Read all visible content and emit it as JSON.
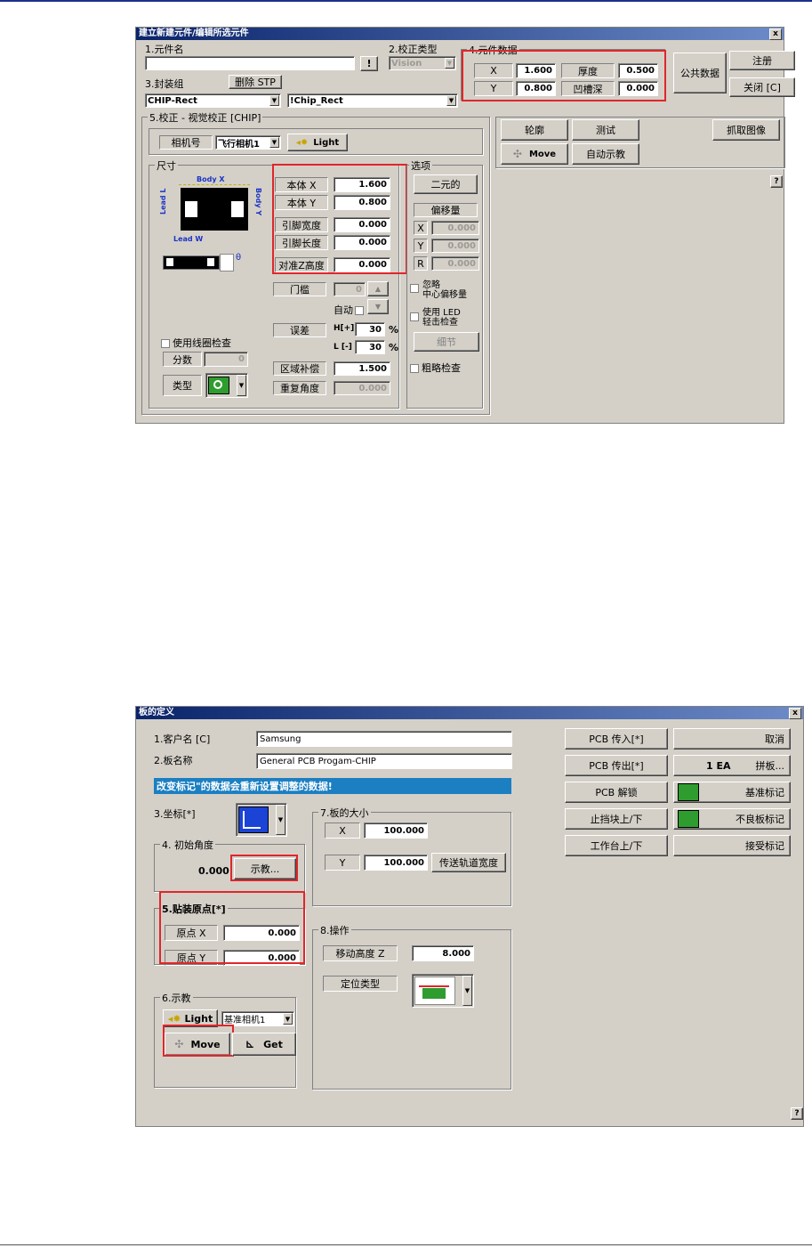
{
  "window1": {
    "title": "建立新建元件/编辑所选元件",
    "close": "x",
    "part_name_label": "1.元件名",
    "part_name_value": "",
    "excl_button": "!",
    "calib_type_label": "2.校正类型",
    "calib_type_value": "Vision",
    "part_data_label": "4.元件数据",
    "x_label": "X",
    "x_value": "1.600",
    "y_label": "Y",
    "y_value": "0.800",
    "thickness_label": "厚度",
    "thickness_value": "0.500",
    "groove_label": "凹槽深",
    "groove_value": "0.000",
    "public_data_button": "公共数据",
    "register_button": "注册",
    "close_button": "关闭 [C]",
    "package_label": "3.封装组",
    "delete_stp_button": "删除 STP",
    "package_value": "CHIP-Rect",
    "package2_value": "!Chip_Rect",
    "vision_group_title": "5.校正 - 视觉校正 [CHIP]",
    "camera_label": "相机号",
    "camera_value": "飞行相机1",
    "light_button": "Light",
    "size_group_title": "尺寸",
    "body_x_diag": "Body X",
    "body_y_diag": "Body Y",
    "lead_l_diag": "Lead L",
    "lead_w_diag": "Lead W",
    "diag_symbol": "θ",
    "body_x_label": "本体 X",
    "body_x_value": "1.600",
    "body_y_label": "本体 Y",
    "body_y_value": "0.800",
    "lead_w_label": "引脚宽度",
    "lead_w_value": "0.000",
    "lead_l_label": "引脚长度",
    "lead_l_value": "0.000",
    "align_z_label": "对准Z高度",
    "align_z_value": "0.000",
    "threshold_label": "门槛",
    "threshold_value": "0",
    "auto_label": "自动",
    "tolerance_label": "误差",
    "h_label": "H[+]",
    "h_value": "30",
    "l_label": "L [-]",
    "l_value": "30",
    "percent": "%",
    "region_comp_label": "区域补偿",
    "region_comp_value": "1.500",
    "repeat_angle_label": "重复角度",
    "repeat_angle_value": "0.000",
    "use_coil_label": "使用线圈检查",
    "score_label": "分数",
    "score_value": "0",
    "type_label": "类型",
    "options_title": "选项",
    "binary_button": "二元的",
    "offset_label": "偏移量",
    "ox_label": "X",
    "ox_value": "0.000",
    "oy_label": "Y",
    "oy_value": "0.000",
    "or_label": "R",
    "or_value": "0.000",
    "ignore_center_label": "忽略\n中心偏移量",
    "use_led_label": "使用 LED\n轻击检查",
    "detail_button": "细节",
    "rough_check_label": "粗略检查",
    "outline_button": "轮廓",
    "test_button": "测试",
    "grab_image_button": "抓取图像",
    "move_button": "Move",
    "auto_teach_button": "自动示教",
    "help": "?"
  },
  "window2": {
    "title": "板的定义",
    "close": "x",
    "customer_label": "1.客户名 [C]",
    "customer_value": "Samsung",
    "board_name_label": "2.板名称",
    "board_name_value": "General PCB Progam-CHIP",
    "notice": "改变标记\"的数据会重新设置调整的数据!",
    "coord_label": "3.坐标[*]",
    "init_angle_label": "4. 初始角度",
    "init_angle_value": "0.000",
    "teach_button": "示教...",
    "origin_label": "5.贴装原点[*]",
    "origin_x_label": "原点 X",
    "origin_x_value": "0.000",
    "origin_y_label": "原点 Y",
    "origin_y_value": "0.000",
    "teach_group_label": "6.示教",
    "light_button": "Light",
    "camera_value": "基准相机1",
    "move_button": "Move",
    "get_button": "Get",
    "board_size_label": "7.板的大小",
    "bx_label": "X",
    "bx_value": "100.000",
    "by_label": "Y",
    "by_value": "100.000",
    "conveyor_width_button": "传送轨道宽度",
    "operation_label": "8.操作",
    "move_height_label": "移动高度 Z",
    "move_height_value": "8.000",
    "locate_type_label": "定位类型",
    "pcb_in_button": "PCB 传入[*]",
    "pcb_out_button": "PCB 传出[*]",
    "pcb_unlock_button": "PCB 解锁",
    "stopper_button": "止挡块上/下",
    "table_button": "工作台上/下",
    "cancel_button": "取消",
    "array_count": "1 EA",
    "array_button": "拼板...",
    "fiducial_button": "基准标记",
    "bad_mark_button": "不良板标记",
    "accept_mark_button": "接受标记",
    "help": "?"
  },
  "colors": {
    "red_highlight": "#e0262a",
    "title_bar": "#0a246a",
    "dialog_bg": "#d4d0c8",
    "notice_bg": "#1b7fc2",
    "green": "#2f9c2f"
  }
}
